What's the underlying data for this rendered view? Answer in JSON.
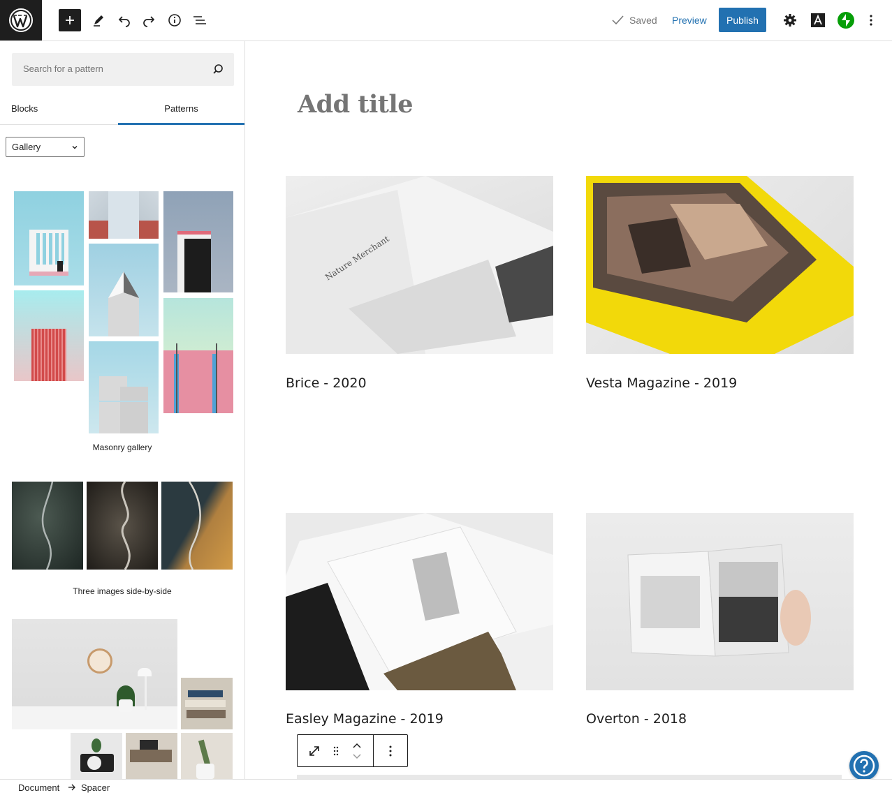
{
  "topbar": {
    "saved_label": "Saved",
    "preview_label": "Preview",
    "publish_label": "Publish",
    "icons": [
      "wordpress-logo-icon",
      "plus-icon",
      "pencil-icon",
      "undo-icon",
      "redo-icon",
      "info-icon",
      "list-view-icon",
      "check-icon",
      "gear-icon",
      "font-a-icon",
      "jetpack-icon",
      "more-vertical-icon"
    ],
    "colors": {
      "accent": "#2271b1",
      "dark": "#1e1e1e",
      "jetpack": "#069e08"
    }
  },
  "sidebar": {
    "search_placeholder": "Search for a pattern",
    "tabs": [
      {
        "label": "Blocks"
      },
      {
        "label": "Patterns"
      }
    ],
    "category_selected": "Gallery",
    "patterns": [
      {
        "label": "Masonry gallery"
      },
      {
        "label": "Three images side-by-side"
      }
    ]
  },
  "editor": {
    "title_placeholder": "Add title",
    "gallery": [
      {
        "caption": "Brice - 2020"
      },
      {
        "caption": "Vesta Magazine - 2019"
      },
      {
        "caption": "Easley Magazine - 2019"
      },
      {
        "caption": "Overton - 2018"
      }
    ]
  },
  "footer": {
    "breadcrumbs": [
      "Document",
      "Spacer"
    ]
  }
}
